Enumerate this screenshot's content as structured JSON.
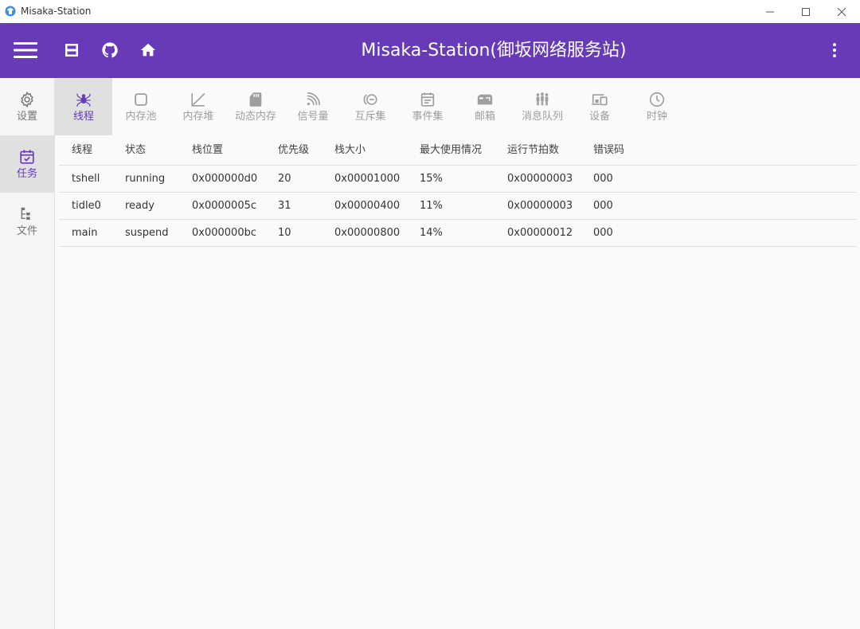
{
  "window": {
    "title": "Misaka-Station"
  },
  "appbar": {
    "title": "Misaka-Station(御坂网络服务站)"
  },
  "sidenav": {
    "items": [
      {
        "label": "设置",
        "icon": "gear-icon"
      },
      {
        "label": "任务",
        "icon": "calendar-check-icon"
      },
      {
        "label": "文件",
        "icon": "file-tree-icon"
      }
    ]
  },
  "tabs": [
    {
      "label": "线程",
      "icon": "spider-icon"
    },
    {
      "label": "内存池",
      "icon": "square-outline-icon"
    },
    {
      "label": "内存堆",
      "icon": "chart-line-icon"
    },
    {
      "label": "动态内存",
      "icon": "sd-card-icon"
    },
    {
      "label": "信号量",
      "icon": "rss-icon"
    },
    {
      "label": "互斥集",
      "icon": "minus-circle-icon"
    },
    {
      "label": "事件集",
      "icon": "calendar-icon"
    },
    {
      "label": "邮箱",
      "icon": "mailbox-icon"
    },
    {
      "label": "消息队列",
      "icon": "people-queue-icon"
    },
    {
      "label": "设备",
      "icon": "devices-icon"
    },
    {
      "label": "时钟",
      "icon": "clock-icon"
    }
  ],
  "table": {
    "columns": [
      "线程",
      "状态",
      "栈位置",
      "优先级",
      "栈大小",
      "最大使用情况",
      "运行节拍数",
      "错误码"
    ],
    "rows": [
      [
        "tshell",
        "running",
        "0x000000d0",
        "20",
        "0x00001000",
        "15%",
        "0x00000003",
        "000"
      ],
      [
        "tidle0",
        "ready",
        "0x0000005c",
        "31",
        "0x00000400",
        "11%",
        "0x00000003",
        "000"
      ],
      [
        "main",
        "suspend",
        "0x000000bc",
        "10",
        "0x00000800",
        "14%",
        "0x00000012",
        "000"
      ]
    ]
  },
  "colors": {
    "primary": "#673ab7",
    "icon_inactive": "#9e9e9e",
    "side_icon_inactive": "#757575"
  }
}
